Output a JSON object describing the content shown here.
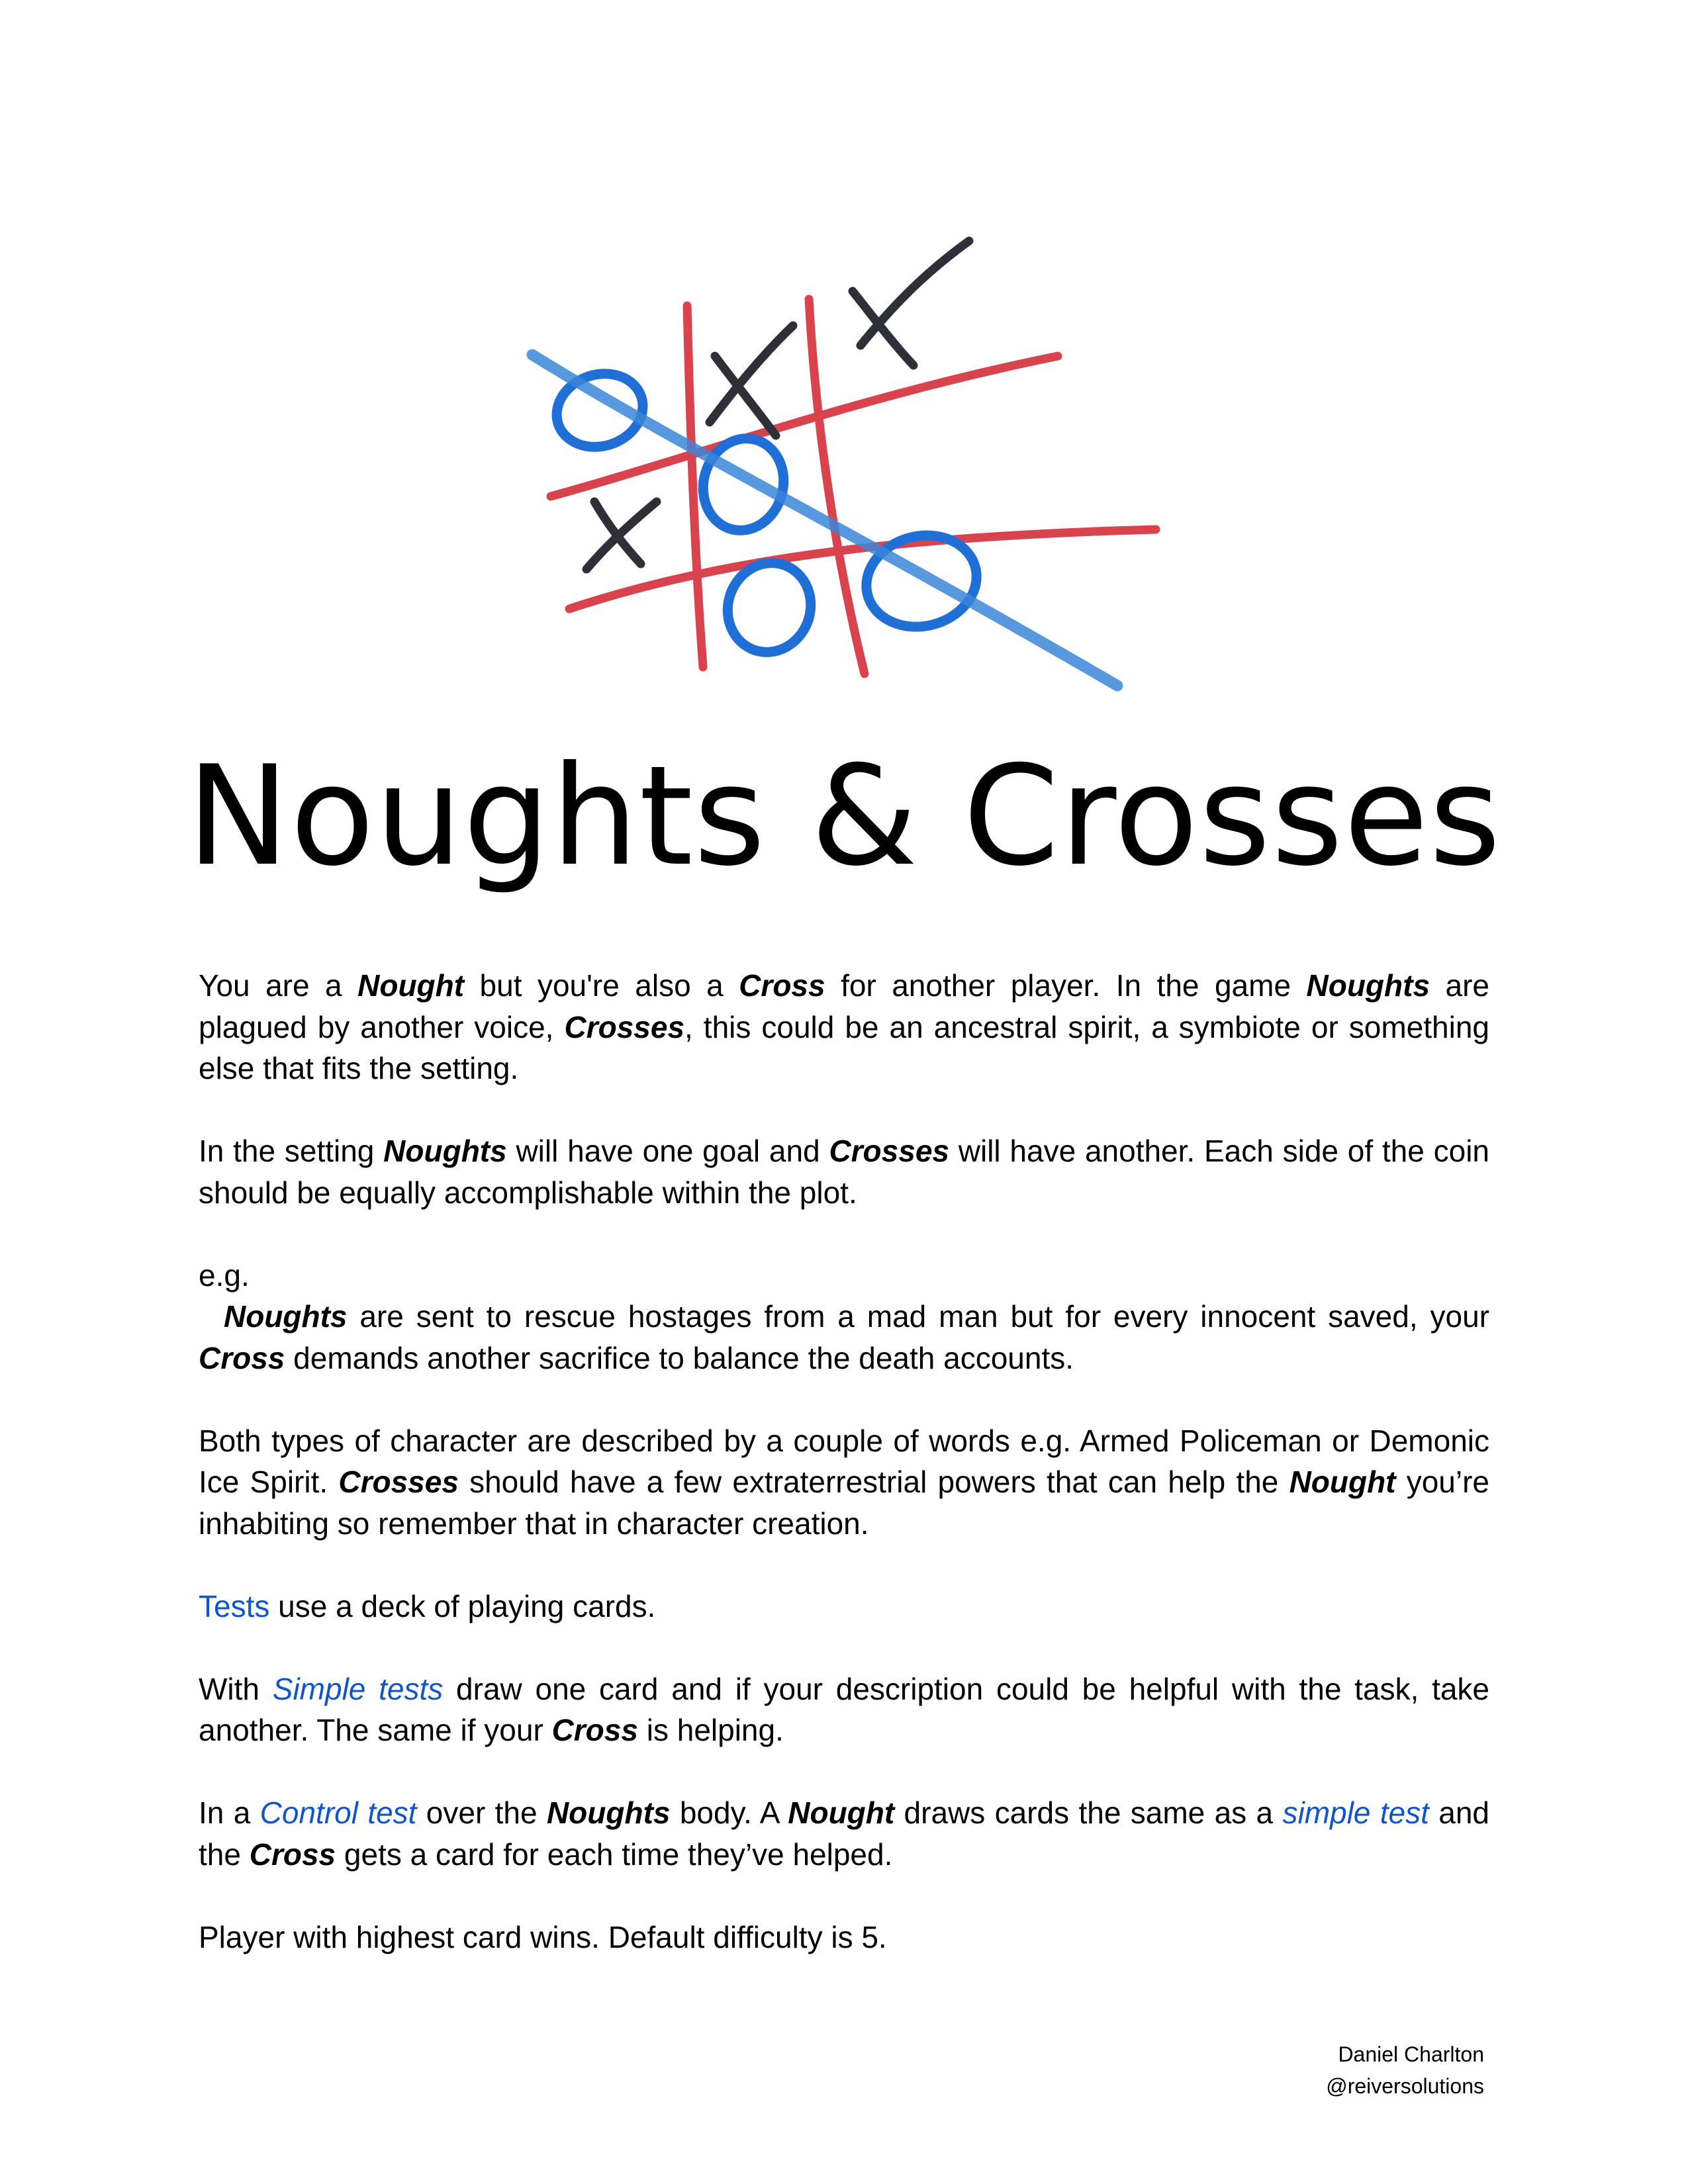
{
  "document": {
    "title": "Noughts & Crosses",
    "paragraphs": [
      {
        "name": "intro-paragraph",
        "segments": [
          {
            "t": "You are a "
          },
          {
            "t": "Nought",
            "s": "kw"
          },
          {
            "t": " but you're also a "
          },
          {
            "t": "Cross",
            "s": "kw"
          },
          {
            "t": " for another player. In the game "
          },
          {
            "t": "Noughts",
            "s": "kw"
          },
          {
            "t": " are plagued by another voice, "
          },
          {
            "t": "Crosses",
            "s": "kw"
          },
          {
            "t": ", this could be an ancestral spirit, a symbiote or something else that fits the setting."
          }
        ]
      },
      {
        "name": "goals-paragraph",
        "segments": [
          {
            "t": "In the setting "
          },
          {
            "t": "Noughts",
            "s": "kw"
          },
          {
            "t": " will have one goal and "
          },
          {
            "t": "Crosses",
            "s": "kw"
          },
          {
            "t": " will have another. Each side of the coin should be equally accomplishable within the plot."
          }
        ]
      },
      {
        "name": "eg-label",
        "cls": "no-gap",
        "segments": [
          {
            "t": "e.g."
          }
        ]
      },
      {
        "name": "example-paragraph",
        "cls": "indent",
        "segments": [
          {
            "t": "Noughts",
            "s": "kw"
          },
          {
            "t": " are sent to rescue hostages from a mad man but for every innocent saved, your "
          },
          {
            "t": "Cross",
            "s": "kw"
          },
          {
            "t": " demands another sacrifice to balance the death accounts."
          }
        ]
      },
      {
        "name": "characters-paragraph",
        "segments": [
          {
            "t": "Both types of character are described by a couple of words e.g. Armed Policeman or Demonic Ice Spirit. "
          },
          {
            "t": "Crosses",
            "s": "kw"
          },
          {
            "t": " should have a few extraterrestrial powers that can help the "
          },
          {
            "t": "Nought",
            "s": "kw"
          },
          {
            "t": " you’re inhabiting so remember that in character creation."
          }
        ]
      },
      {
        "name": "tests-paragraph",
        "segments": [
          {
            "t": "Tests",
            "s": "link"
          },
          {
            "t": " use a deck of playing cards."
          }
        ]
      },
      {
        "name": "simple-tests-paragraph",
        "segments": [
          {
            "t": "With "
          },
          {
            "t": "Simple tests",
            "s": "link-i"
          },
          {
            "t": " draw one card and if your description could be helpful with the task, take another. The same if your "
          },
          {
            "t": "Cross",
            "s": "kw"
          },
          {
            "t": " is helping."
          }
        ]
      },
      {
        "name": "control-test-paragraph",
        "segments": [
          {
            "t": "In a "
          },
          {
            "t": "Control test",
            "s": "link-i"
          },
          {
            "t": " over the "
          },
          {
            "t": "Noughts",
            "s": "kw"
          },
          {
            "t": " body. A "
          },
          {
            "t": "Nought",
            "s": "kw"
          },
          {
            "t": " draws cards the same as a "
          },
          {
            "t": "simple test",
            "s": "link-i"
          },
          {
            "t": " and the "
          },
          {
            "t": "Cross",
            "s": "kw"
          },
          {
            "t": " gets a card for each time they’ve helped."
          }
        ]
      },
      {
        "name": "winner-paragraph",
        "segments": [
          {
            "t": "Player with highest card wins. Default difficulty is 5."
          }
        ]
      }
    ],
    "credit": {
      "author": "Daniel Charlton",
      "handle": "@reiversolutions"
    }
  },
  "illustration": {
    "icon": "tic-tac-toe-drawing",
    "colors": {
      "grid": "#d9434d",
      "nought": "#1f6fd6",
      "cross": "#2f2f3a",
      "strike": "#3b86d8"
    }
  }
}
